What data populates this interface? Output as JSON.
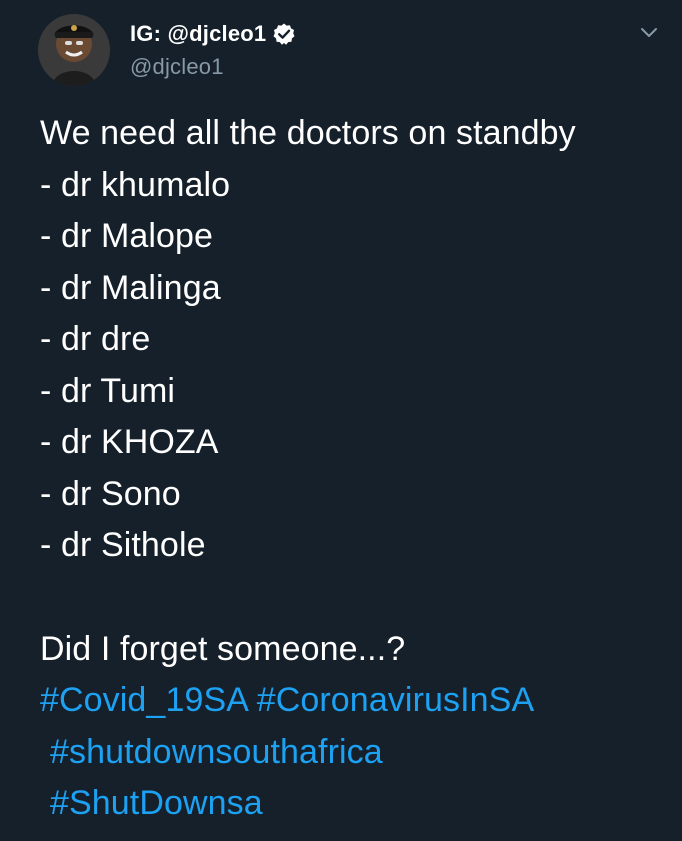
{
  "author": {
    "display_name": "IG: @djcleo1",
    "handle": "@djcleo1",
    "verified": true,
    "avatar_icon": "user-avatar-photo"
  },
  "tweet": {
    "intro": "We need all the doctors on standby",
    "doctors": [
      "- dr khumalo",
      "- dr Malope",
      "- dr Malinga",
      "- dr dre",
      "- dr Tumi",
      "- dr KHOZA",
      "- dr Sono",
      "- dr Sithole"
    ],
    "question": "Did I forget someone...?",
    "hashtags": [
      "#Covid_19SA",
      "#CoronavirusInSA",
      "#shutdownsouthafrica",
      "#ShutDownsa"
    ]
  },
  "colors": {
    "background": "#15202b",
    "text": "#ffffff",
    "secondary_text": "#8899a6",
    "link": "#1da1f2"
  },
  "icons": {
    "verified": "verified-badge-icon",
    "menu": "chevron-down-icon"
  }
}
